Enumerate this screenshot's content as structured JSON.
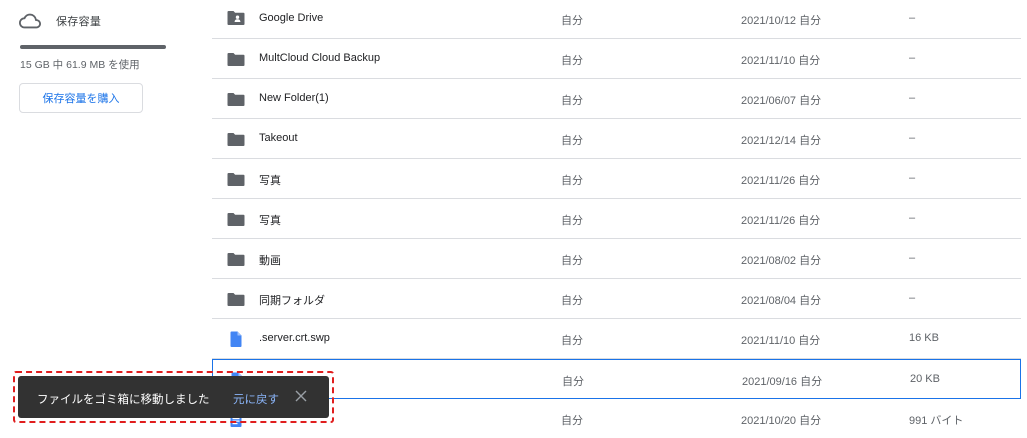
{
  "sidebar": {
    "storage_title": "保存容量",
    "storage_used_fraction": 1.0,
    "storage_text": "15 GB 中 61.9 MB を使用",
    "buy_button": "保存容量を購入",
    "icons": {
      "storage": "cloud-icon"
    }
  },
  "files": [
    {
      "name": "Google Drive",
      "owner": "自分",
      "modified": "2021/10/12 自分",
      "size": "–",
      "icon": "shared-folder-icon"
    },
    {
      "name": "MultCloud Cloud Backup",
      "owner": "自分",
      "modified": "2021/11/10 自分",
      "size": "–",
      "icon": "folder-icon"
    },
    {
      "name": "New Folder(1)",
      "owner": "自分",
      "modified": "2021/06/07 自分",
      "size": "–",
      "icon": "folder-icon"
    },
    {
      "name": "Takeout",
      "owner": "自分",
      "modified": "2021/12/14 自分",
      "size": "–",
      "icon": "folder-icon"
    },
    {
      "name": "写真",
      "owner": "自分",
      "modified": "2021/11/26 自分",
      "size": "–",
      "icon": "folder-icon"
    },
    {
      "name": "写真",
      "owner": "自分",
      "modified": "2021/11/26 自分",
      "size": "–",
      "icon": "folder-icon"
    },
    {
      "name": "動画",
      "owner": "自分",
      "modified": "2021/08/02 自分",
      "size": "–",
      "icon": "folder-icon"
    },
    {
      "name": "同期フォルダ",
      "owner": "自分",
      "modified": "2021/08/04 自分",
      "size": "–",
      "icon": "folder-icon"
    },
    {
      "name": ".server.crt.swp",
      "owner": "自分",
      "modified": "2021/11/10 自分",
      "size": "16 KB",
      "icon": "file-icon"
    },
    {
      "name": "",
      "owner": "自分",
      "modified": "2021/09/16 自分",
      "size": "20 KB",
      "icon": "file-icon"
    },
    {
      "name": "",
      "owner": "自分",
      "modified": "2021/10/20 自分",
      "size": "991 バイト",
      "icon": "doc-icon"
    }
  ],
  "toast": {
    "message": "ファイルをゴミ箱に移動しました",
    "undo_label": "元に戻す",
    "close_icon": "close-icon"
  },
  "colors": {
    "accent": "#1a73e8",
    "toast_bg": "#323232",
    "toast_link": "#8ab4f8",
    "highlight": "#e01e1e"
  }
}
